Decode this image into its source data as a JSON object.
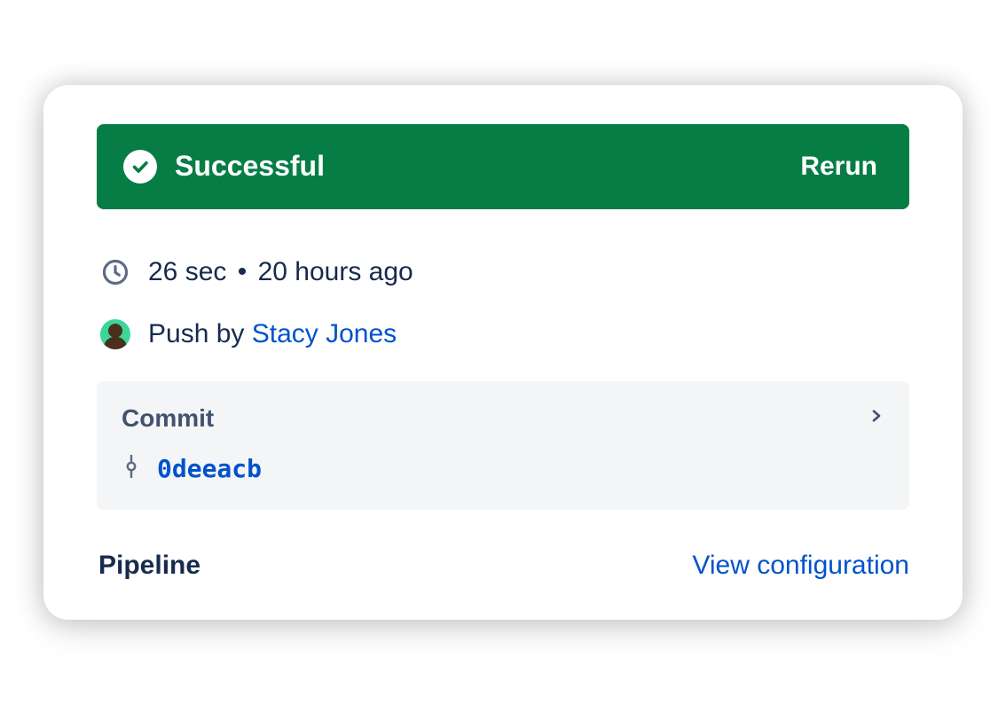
{
  "status": {
    "label": "Successful",
    "rerun": "Rerun"
  },
  "meta": {
    "duration": "26 sec",
    "timeago": "20 hours ago",
    "event_prefix": "Push by",
    "author": "Stacy Jones"
  },
  "commit": {
    "title": "Commit",
    "hash": "0deeacb"
  },
  "pipeline": {
    "title": "Pipeline",
    "view_config": "View configuration"
  },
  "colors": {
    "banner": "#057d45",
    "link": "#0052cc",
    "muted": "#42526e"
  }
}
